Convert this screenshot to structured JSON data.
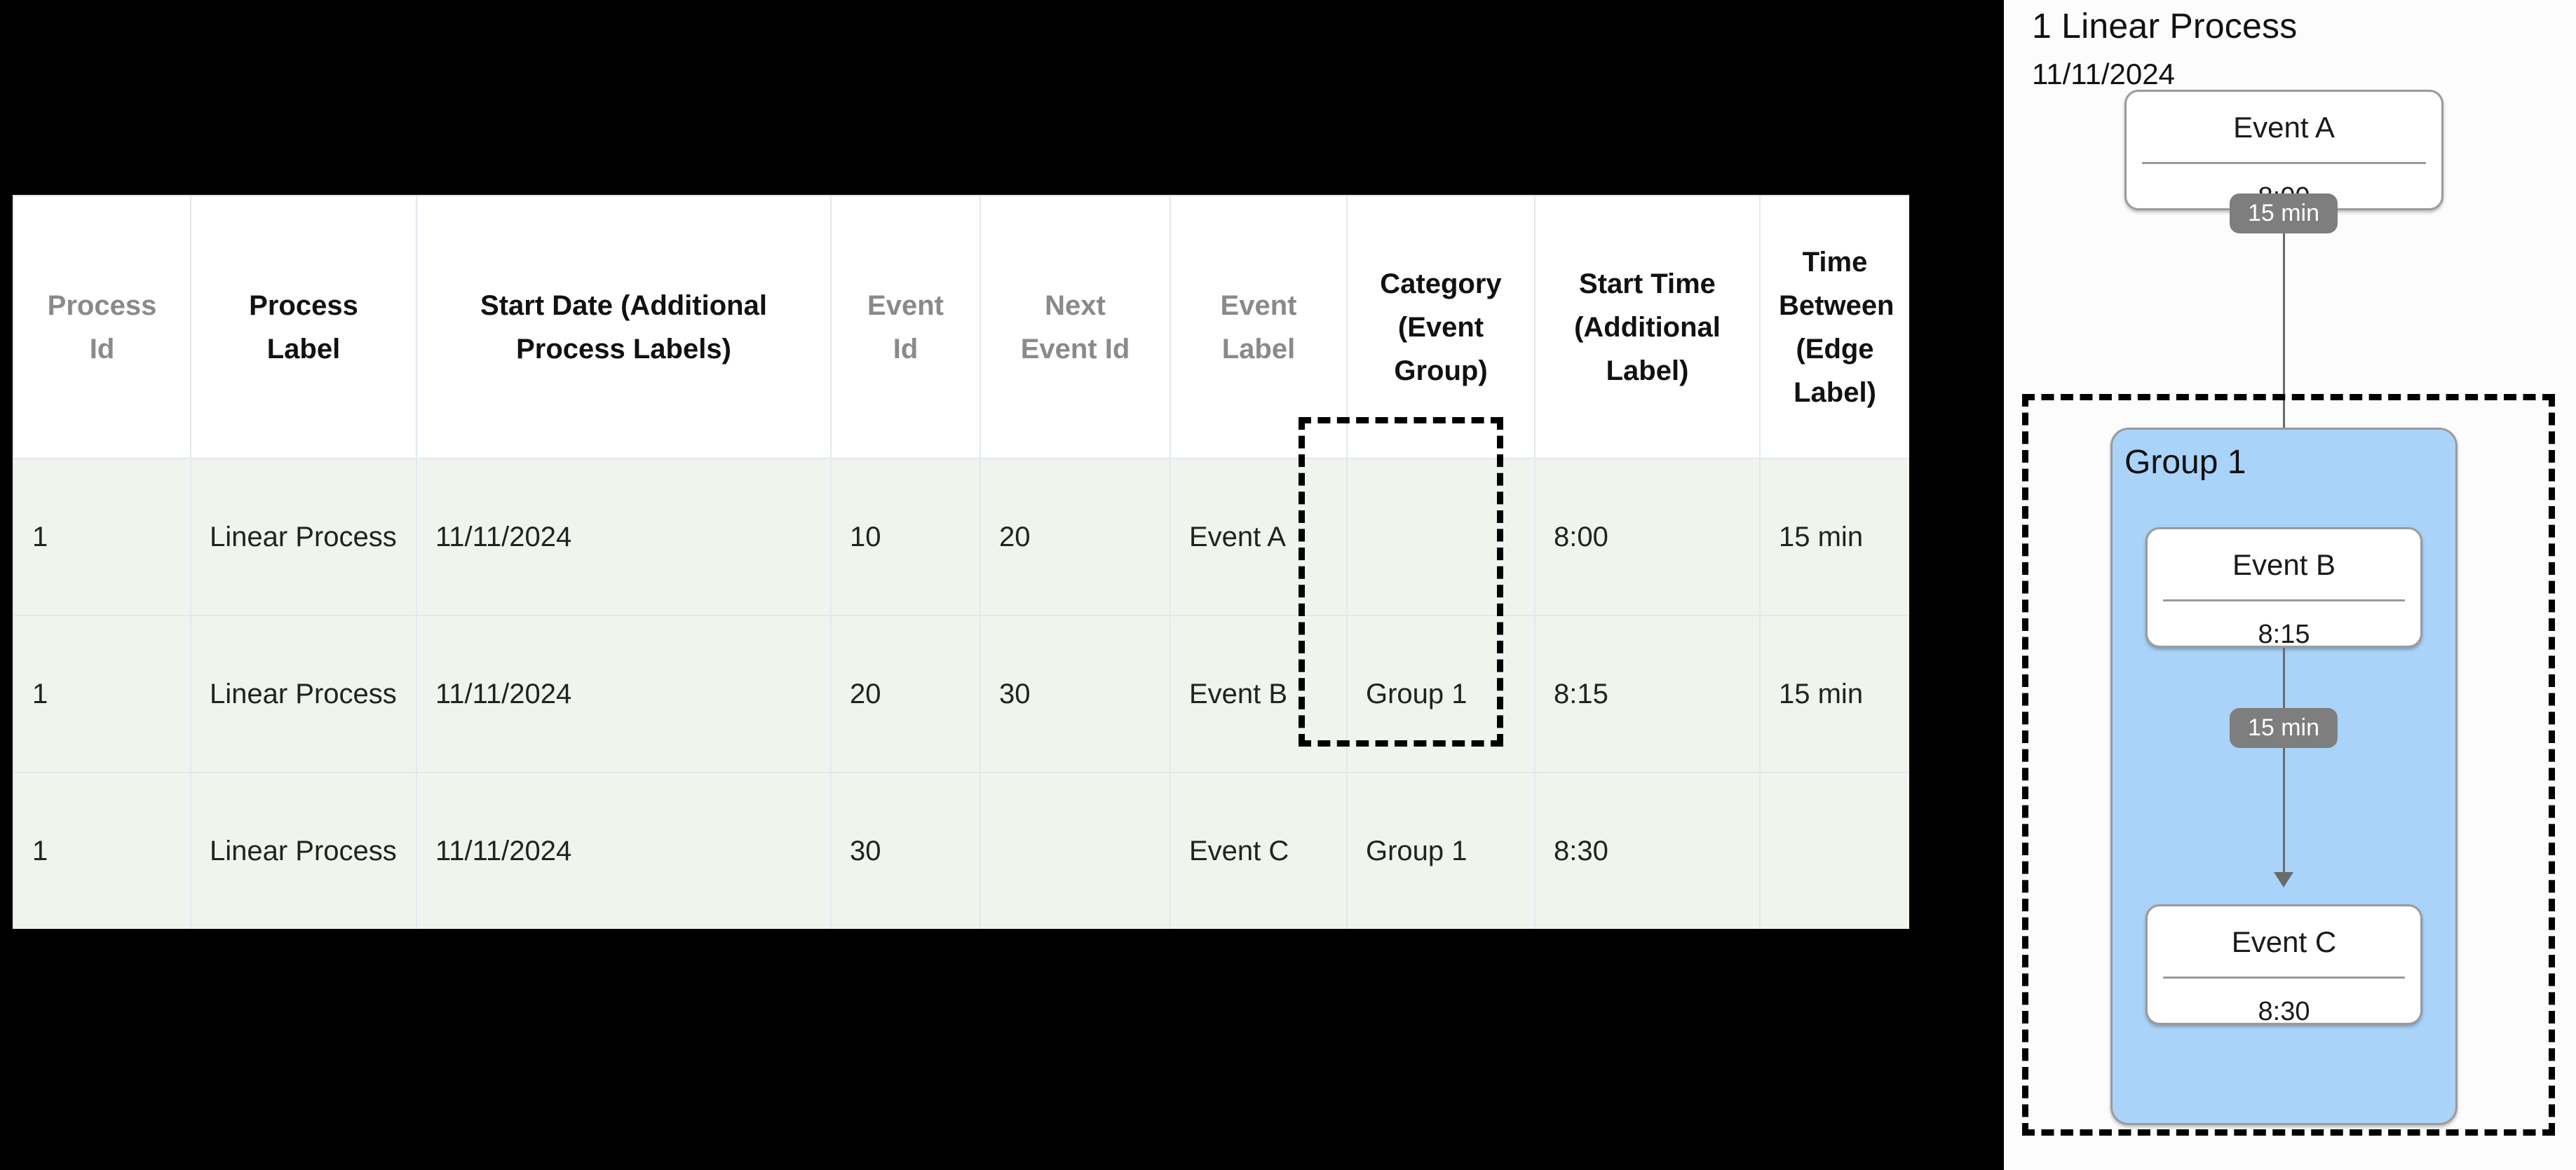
{
  "table": {
    "columns": [
      {
        "label": "Process\nId",
        "muted": true
      },
      {
        "label": "Process\nLabel",
        "muted": false
      },
      {
        "label": "Start Date (Additional\nProcess Labels)",
        "muted": false
      },
      {
        "label": "Event\nId",
        "muted": true
      },
      {
        "label": "Next\nEvent Id",
        "muted": true
      },
      {
        "label": "Event\nLabel",
        "muted": true
      },
      {
        "label": "Category\n(Event\nGroup)",
        "muted": false
      },
      {
        "label": "Start Time\n(Additional\nLabel)",
        "muted": false
      },
      {
        "label": "Time\nBetween\n(Edge\nLabel)",
        "muted": false
      }
    ],
    "headers": [
      "Process Id",
      "Process Label",
      "Start Date (Additional Process Labels)",
      "Event Id",
      "Next Event Id",
      "Event Label",
      "Category (Event Group)",
      "Start Time (Additional Label)",
      "Time Between (Edge Label)"
    ],
    "rows": [
      {
        "process_id": "1",
        "process_label": "Linear Process",
        "start_date": "11/11/2024",
        "event_id": "10",
        "next_event_id": "20",
        "event_label": "Event A",
        "category": "",
        "start_time": "8:00",
        "time_between": "15 min"
      },
      {
        "process_id": "1",
        "process_label": "Linear Process",
        "start_date": "11/11/2024",
        "event_id": "20",
        "next_event_id": "30",
        "event_label": "Event B",
        "category": "Group 1",
        "start_time": "8:15",
        "time_between": "15 min"
      },
      {
        "process_id": "1",
        "process_label": "Linear Process",
        "start_date": "11/11/2024",
        "event_id": "30",
        "next_event_id": "",
        "event_label": "Event C",
        "category": "Group 1",
        "start_time": "8:30",
        "time_between": ""
      }
    ]
  },
  "diagram": {
    "title": "1 Linear Process",
    "date": "11/11/2024",
    "group_label": "Group 1",
    "nodes": [
      {
        "label": "Event A",
        "time": "8:00"
      },
      {
        "label": "Event B",
        "time": "8:15"
      },
      {
        "label": "Event C",
        "time": "8:30"
      }
    ],
    "edges": [
      {
        "label": "15 min"
      },
      {
        "label": "15 min"
      }
    ],
    "colors": {
      "group_fill": "#a9d3f8",
      "node_fill": "#ffffff",
      "node_border": "#9b9b9b",
      "edge": "#6a6a6a",
      "badge_fill": "#7e7e7e",
      "badge_text": "#ffffff",
      "dashed_border": "#000000",
      "row_fill": "#eff5ec",
      "grid_line": "#e4e7ee",
      "muted_header": "#8a8a8a"
    }
  }
}
